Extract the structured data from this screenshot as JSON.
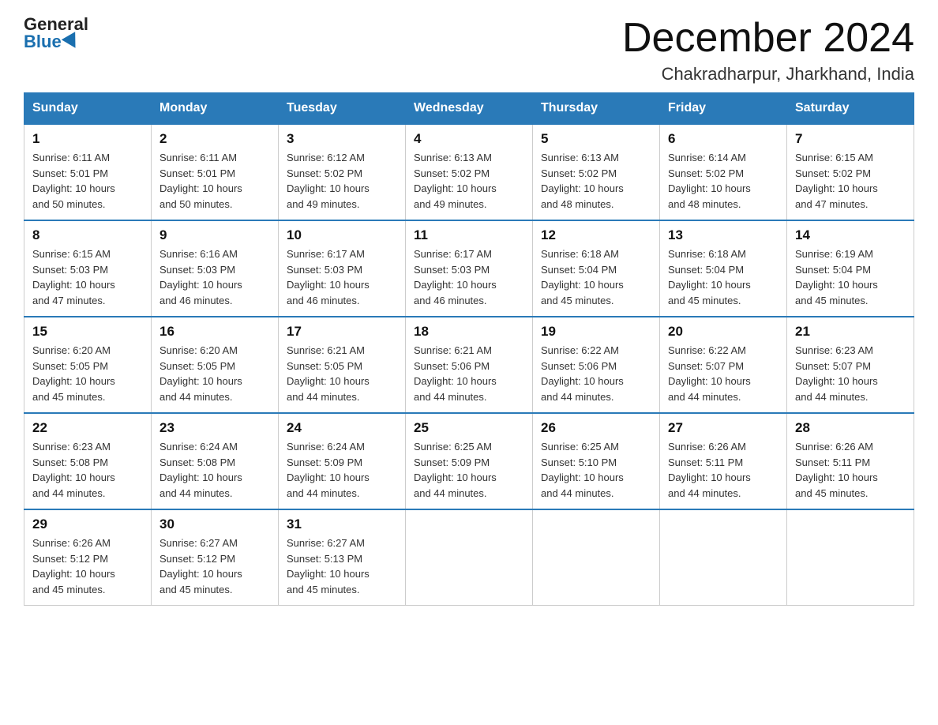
{
  "logo": {
    "general": "General",
    "blue": "Blue"
  },
  "title": "December 2024",
  "subtitle": "Chakradharpur, Jharkhand, India",
  "days_of_week": [
    "Sunday",
    "Monday",
    "Tuesday",
    "Wednesday",
    "Thursday",
    "Friday",
    "Saturday"
  ],
  "weeks": [
    [
      {
        "day": "1",
        "sunrise": "6:11 AM",
        "sunset": "5:01 PM",
        "daylight": "10 hours and 50 minutes."
      },
      {
        "day": "2",
        "sunrise": "6:11 AM",
        "sunset": "5:01 PM",
        "daylight": "10 hours and 50 minutes."
      },
      {
        "day": "3",
        "sunrise": "6:12 AM",
        "sunset": "5:02 PM",
        "daylight": "10 hours and 49 minutes."
      },
      {
        "day": "4",
        "sunrise": "6:13 AM",
        "sunset": "5:02 PM",
        "daylight": "10 hours and 49 minutes."
      },
      {
        "day": "5",
        "sunrise": "6:13 AM",
        "sunset": "5:02 PM",
        "daylight": "10 hours and 48 minutes."
      },
      {
        "day": "6",
        "sunrise": "6:14 AM",
        "sunset": "5:02 PM",
        "daylight": "10 hours and 48 minutes."
      },
      {
        "day": "7",
        "sunrise": "6:15 AM",
        "sunset": "5:02 PM",
        "daylight": "10 hours and 47 minutes."
      }
    ],
    [
      {
        "day": "8",
        "sunrise": "6:15 AM",
        "sunset": "5:03 PM",
        "daylight": "10 hours and 47 minutes."
      },
      {
        "day": "9",
        "sunrise": "6:16 AM",
        "sunset": "5:03 PM",
        "daylight": "10 hours and 46 minutes."
      },
      {
        "day": "10",
        "sunrise": "6:17 AM",
        "sunset": "5:03 PM",
        "daylight": "10 hours and 46 minutes."
      },
      {
        "day": "11",
        "sunrise": "6:17 AM",
        "sunset": "5:03 PM",
        "daylight": "10 hours and 46 minutes."
      },
      {
        "day": "12",
        "sunrise": "6:18 AM",
        "sunset": "5:04 PM",
        "daylight": "10 hours and 45 minutes."
      },
      {
        "day": "13",
        "sunrise": "6:18 AM",
        "sunset": "5:04 PM",
        "daylight": "10 hours and 45 minutes."
      },
      {
        "day": "14",
        "sunrise": "6:19 AM",
        "sunset": "5:04 PM",
        "daylight": "10 hours and 45 minutes."
      }
    ],
    [
      {
        "day": "15",
        "sunrise": "6:20 AM",
        "sunset": "5:05 PM",
        "daylight": "10 hours and 45 minutes."
      },
      {
        "day": "16",
        "sunrise": "6:20 AM",
        "sunset": "5:05 PM",
        "daylight": "10 hours and 44 minutes."
      },
      {
        "day": "17",
        "sunrise": "6:21 AM",
        "sunset": "5:05 PM",
        "daylight": "10 hours and 44 minutes."
      },
      {
        "day": "18",
        "sunrise": "6:21 AM",
        "sunset": "5:06 PM",
        "daylight": "10 hours and 44 minutes."
      },
      {
        "day": "19",
        "sunrise": "6:22 AM",
        "sunset": "5:06 PM",
        "daylight": "10 hours and 44 minutes."
      },
      {
        "day": "20",
        "sunrise": "6:22 AM",
        "sunset": "5:07 PM",
        "daylight": "10 hours and 44 minutes."
      },
      {
        "day": "21",
        "sunrise": "6:23 AM",
        "sunset": "5:07 PM",
        "daylight": "10 hours and 44 minutes."
      }
    ],
    [
      {
        "day": "22",
        "sunrise": "6:23 AM",
        "sunset": "5:08 PM",
        "daylight": "10 hours and 44 minutes."
      },
      {
        "day": "23",
        "sunrise": "6:24 AM",
        "sunset": "5:08 PM",
        "daylight": "10 hours and 44 minutes."
      },
      {
        "day": "24",
        "sunrise": "6:24 AM",
        "sunset": "5:09 PM",
        "daylight": "10 hours and 44 minutes."
      },
      {
        "day": "25",
        "sunrise": "6:25 AM",
        "sunset": "5:09 PM",
        "daylight": "10 hours and 44 minutes."
      },
      {
        "day": "26",
        "sunrise": "6:25 AM",
        "sunset": "5:10 PM",
        "daylight": "10 hours and 44 minutes."
      },
      {
        "day": "27",
        "sunrise": "6:26 AM",
        "sunset": "5:11 PM",
        "daylight": "10 hours and 44 minutes."
      },
      {
        "day": "28",
        "sunrise": "6:26 AM",
        "sunset": "5:11 PM",
        "daylight": "10 hours and 45 minutes."
      }
    ],
    [
      {
        "day": "29",
        "sunrise": "6:26 AM",
        "sunset": "5:12 PM",
        "daylight": "10 hours and 45 minutes."
      },
      {
        "day": "30",
        "sunrise": "6:27 AM",
        "sunset": "5:12 PM",
        "daylight": "10 hours and 45 minutes."
      },
      {
        "day": "31",
        "sunrise": "6:27 AM",
        "sunset": "5:13 PM",
        "daylight": "10 hours and 45 minutes."
      },
      null,
      null,
      null,
      null
    ]
  ],
  "labels": {
    "sunrise": "Sunrise:",
    "sunset": "Sunset:",
    "daylight": "Daylight:"
  }
}
